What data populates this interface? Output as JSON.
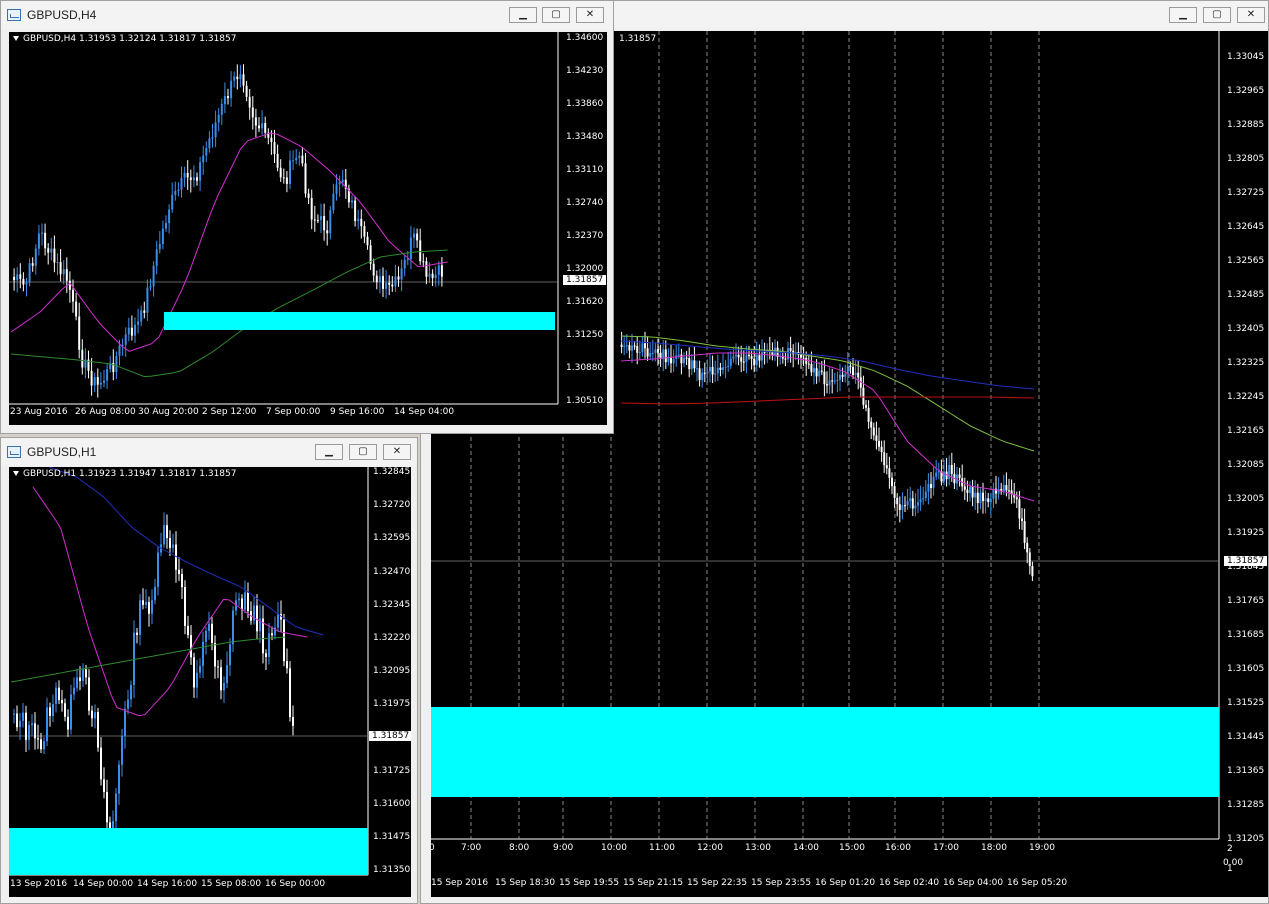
{
  "windows": {
    "h4": {
      "title": "GBPUSD,H4",
      "info": "GBPUSD,H4  1.31953 1.32124 1.31817 1.31857",
      "prices": [
        "1.34600",
        "1.34230",
        "1.33860",
        "1.33480",
        "1.33110",
        "1.32740",
        "1.32370",
        "1.32000",
        "1.31620",
        "1.31250",
        "1.30880",
        "1.30510"
      ],
      "current": "1.31857",
      "times": [
        "23 Aug 2016",
        "26 Aug 08:00",
        "30 Aug 20:00",
        "2 Sep 12:00",
        "7 Sep 00:00",
        "9 Sep 16:00",
        "14 Sep 04:00"
      ]
    },
    "h1": {
      "title": "GBPUSD,H1",
      "info": "GBPUSD,H1  1.31923 1.31947 1.31817 1.31857",
      "prices": [
        "1.32845",
        "1.32720",
        "1.32595",
        "1.32470",
        "1.32345",
        "1.32220",
        "1.32095",
        "1.31975",
        "1.31850",
        "1.31725",
        "1.31600",
        "1.31475",
        "1.31350"
      ],
      "current": "1.31857",
      "times": [
        "13 Sep 2016",
        "14 Sep 00:00",
        "14 Sep 16:00",
        "15 Sep 08:00",
        "16 Sep 00:00"
      ]
    },
    "m5": {
      "info": "1.31857",
      "prices": [
        "1.33045",
        "1.32965",
        "1.32885",
        "1.32805",
        "1.32725",
        "1.32645",
        "1.32565",
        "1.32485",
        "1.32405",
        "1.32325",
        "1.32245",
        "1.32165",
        "1.32085",
        "1.32005",
        "1.31925",
        "1.31845",
        "1.31765",
        "1.31685",
        "1.31605",
        "1.31525",
        "1.31445",
        "1.31365",
        "1.31285",
        "1.31205"
      ],
      "current": "1.31857",
      "hours": [
        "0",
        "7:00",
        "8:00",
        "9:00",
        "10:00",
        "11:00",
        "12:00",
        "13:00",
        "14:00",
        "15:00",
        "16:00",
        "17:00",
        "18:00",
        "19:00"
      ],
      "times": [
        "15 Sep 2016",
        "15 Sep 18:30",
        "15 Sep 19:55",
        "15 Sep 21:15",
        "15 Sep 22:35",
        "15 Sep 23:55",
        "16 Sep 01:20",
        "16 Sep 02:40",
        "16 Sep 04:00",
        "16 Sep 05:20"
      ],
      "indicator_top": "2",
      "indicator_bottom": "0.00",
      "indicator_mid": "1"
    }
  },
  "buttons": {
    "minimize": "▁",
    "maximize": "▢",
    "close": "✕"
  },
  "colors": {
    "zone": "#00ffff",
    "bull": "#3b8eea",
    "bear": "#ffffff",
    "ma_fast": "#d12fd1",
    "ma_slow": "#2e8b2e",
    "ma_blue": "#2030c0",
    "ma_red": "#c01010",
    "ma_lime": "#7cc042"
  },
  "symbol_info": {
    "h4": {
      "symbol": "GBPUSD,H4",
      "open": "1.31953",
      "high": "1.32124",
      "low": "1.31817",
      "close": "1.31857"
    },
    "h1": {
      "symbol": "GBPUSD,H1",
      "open": "1.31923",
      "high": "1.31947",
      "low": "1.31817",
      "close": "1.31857"
    }
  }
}
